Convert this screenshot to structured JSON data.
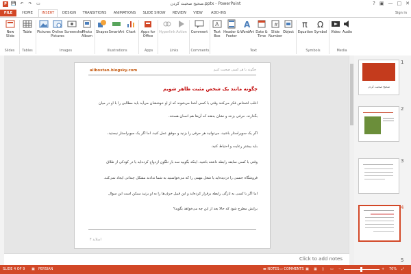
{
  "window": {
    "title": "صحیح صحبت کردن.pptx - PowerPoint"
  },
  "quick_access": {
    "app_icon": "P",
    "save": "💾",
    "undo": "↶",
    "redo": "↷",
    "present": "▭"
  },
  "window_controls": {
    "help": "?",
    "restore": "▣",
    "minimize": "—",
    "maximize": "□",
    "close": "✕"
  },
  "tabs": [
    "FILE",
    "HOME",
    "INSERT",
    "DESIGN",
    "TRANSITIONS",
    "ANIMATIONS",
    "SLIDE SHOW",
    "REVIEW",
    "VIEW",
    "ADD-INS"
  ],
  "active_tab": "INSERT",
  "user": "Sign in",
  "ribbon": {
    "buttons": [
      "New Slide",
      "Table",
      "Pictures",
      "Online Pictures",
      "Screenshot",
      "Photo Album",
      "Shapes",
      "SmartArt",
      "Chart",
      "Apps for Office",
      "Hyperlink",
      "Action",
      "Comment",
      "Text Box",
      "Header & Footer",
      "WordArt",
      "Date & Time",
      "Slide Number",
      "Object",
      "Equation",
      "Symbol",
      "Video",
      "Audio"
    ],
    "groups": [
      "Slides",
      "Tables",
      "Images",
      "Illustrations",
      "Apps",
      "Links",
      "Comments",
      "Text",
      "Symbols",
      "Media"
    ]
  },
  "slide": {
    "site": "allbostan.blogsky.com",
    "header_right": "چگونه با هر کسی صحبت کنیم",
    "title": "چگونه مانند یک شخص مثبت ظاهر شویم",
    "paragraphs": [
      "اغلب اشخاص فکر می‌کنند وقتی با کسی آشنا می‌شوند که از او خوششان می‌آید باید مطالبی را با او در میان",
      "بگذارند، حرفی بزنند و نشان بدهند که آن‌ها هم انسان هستند.",
      "اگر یک سوپراستار باشید، می‌توانید هر حرفی را بزنید و موفق عمل کنید. اما اگر یک سوپراستار نیستید،",
      "باید بیشتر رعایت و احتیاط کنید.",
      "وقتی با کسی سابقه رابطه داشته باشید، اینکه بگویید سه بار تلگون ازدواج کرده‌اید یا در کودکی از طلاق",
      "فروشگاه جنسی را دزدیده‌اید یا شغل مهمی را که می‌خواستید به شما ندادند مشکل چندانی ایجاد نمی‌کند.",
      "اما اگر با کسی به تازگی رابطه برقرار کرده‌اید و این قبیل حرف‌ها را به او بزنید ممکن است این سوال",
      "برایش مطرح شود که حالا بعد از این چه می‌خواهد بگوید؟"
    ],
    "footer": "اسلاید ۴"
  },
  "thumbnails": [
    {
      "num": "1",
      "title": "صحیح صحبت کردن"
    },
    {
      "num": "2"
    },
    {
      "num": "3"
    },
    {
      "num": "4"
    },
    {
      "num": "5"
    }
  ],
  "notes_placeholder": "Click to add notes",
  "status": {
    "slide": "SLIDE 4 OF 9",
    "language": "PERSIAN",
    "notes": "NOTES",
    "comments": "COMMENTS",
    "zoom": "70%",
    "zoom_out": "−",
    "zoom_in": "+"
  },
  "colors": {
    "accent": "#d24726",
    "title": "#c00000"
  }
}
